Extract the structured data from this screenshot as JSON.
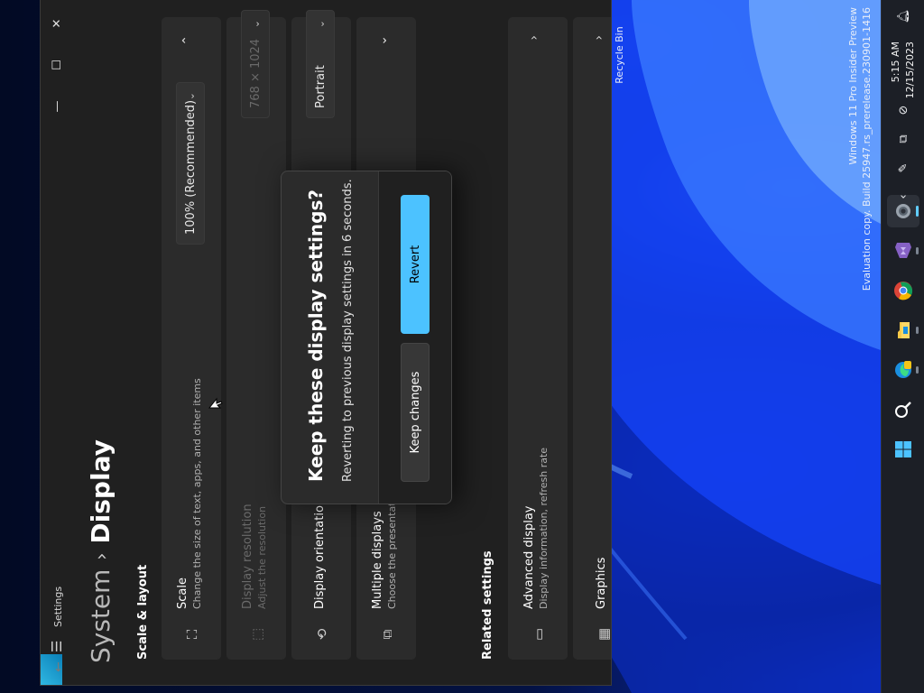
{
  "desktop": {
    "recycle_bin_label": "Recycle Bin",
    "watermark_line1": "Windows 11 Pro Insider Preview",
    "watermark_line2": "Evaluation copy. Build 25947.rs_prerelease.230901-1416"
  },
  "taskbar": {
    "apps": [
      "windows-start",
      "search",
      "edge-beta",
      "file-explorer",
      "chrome",
      "visual-studio",
      "settings"
    ],
    "clock_time": "5:15 AM",
    "clock_date": "12/15/2023"
  },
  "settings": {
    "app_title": "Settings",
    "breadcrumb_parent": "System",
    "breadcrumb_separator": "›",
    "breadcrumb_current": "Display",
    "section_scale_layout": "Scale & layout",
    "section_related": "Related settings",
    "cards": {
      "scale": {
        "title": "Scale",
        "subtitle": "Change the size of text, apps, and other items",
        "value": "100% (Recommended)"
      },
      "resolution": {
        "title": "Display resolution",
        "subtitle": "Adjust the resolution",
        "value": "768 × 1024"
      },
      "orientation": {
        "title": "Display orientation",
        "value": "Portrait"
      },
      "multiple": {
        "title": "Multiple displays",
        "subtitle": "Choose the presentat"
      },
      "advanced": {
        "title": "Advanced display",
        "subtitle": "Display information, refresh rate"
      },
      "graphics": {
        "title": "Graphics"
      }
    }
  },
  "dialog": {
    "title": "Keep these display settings?",
    "message": "Reverting to previous display settings in  6 seconds.",
    "keep_label": "Keep changes",
    "revert_label": "Revert"
  },
  "colors": {
    "accent": "#4cc2ff",
    "window_bg": "#202020",
    "card_bg": "#2b2b2b",
    "taskbar_bg": "#1c1f26"
  }
}
